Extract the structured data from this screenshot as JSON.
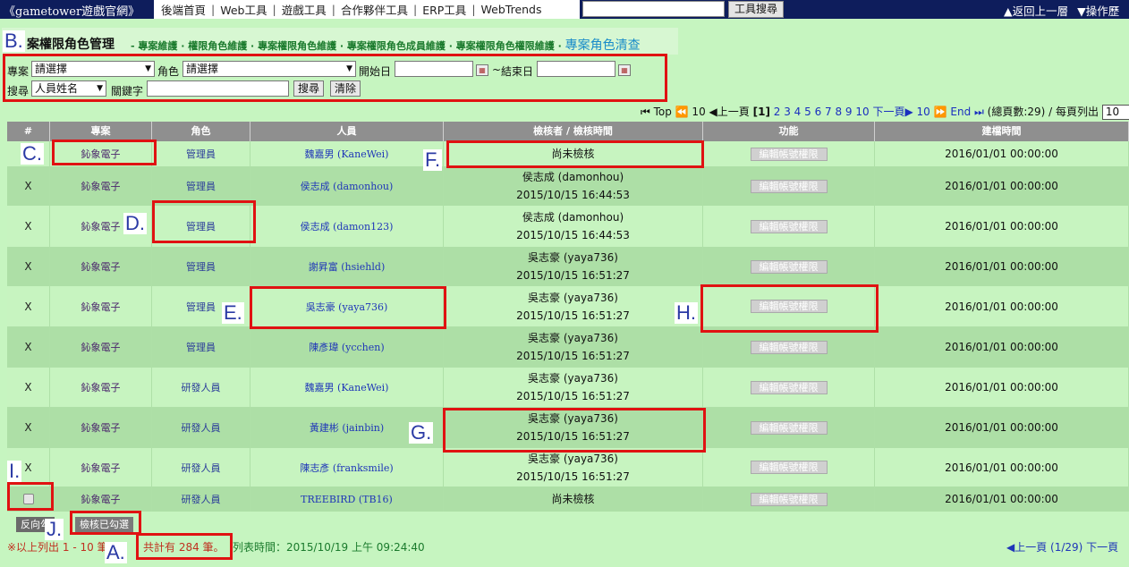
{
  "topbar": {
    "brand": "《gametower遊戲官網》",
    "nav": [
      "後端首頁",
      "Web工具",
      "遊戲工具",
      "合作夥伴工具",
      "ERP工具",
      "WebTrends"
    ],
    "search_value": "",
    "search_button": "工具搜尋",
    "back": "▲返回上一層",
    "history": "▼操作歷"
  },
  "page": {
    "title": "案權限角色管理",
    "crumbs": "- 專案維護 · 權限角色維護 · 專案權限角色維護 · 專案權限角色成員維護 · 專案權限角色權限維護 ·",
    "crumb_current": "專案角色清查"
  },
  "filters": {
    "project_label": "專案",
    "project_value": "請選擇",
    "role_label": "角色",
    "role_value": "請選擇",
    "start_label": "開始日",
    "range_sep": "~",
    "end_label": "結束日",
    "search_label": "搜尋",
    "search_field": "人員姓名",
    "keyword_label": "關鍵字",
    "search_button": "搜尋",
    "clear_button": "清除"
  },
  "pager": {
    "top": "⏮ Top ⏪ 10",
    "prev": "◀上一頁",
    "current": "[1]",
    "pages": "2 3 4 5 6 7 8 9 10",
    "next": "下一頁▶",
    "next10": "10 ⏩",
    "end": "End ⏭",
    "total_pages": "(總頁數:29)",
    "per_page_label": "/ 每頁列出",
    "per_page": "10",
    "tail": "筆"
  },
  "table": {
    "headers": [
      "#",
      "專案",
      "角色",
      "人員",
      "檢核者 / 檢核時間",
      "功能",
      "建檔時間"
    ],
    "rows": [
      {
        "mark": "",
        "project": "鈊象電子",
        "role": "管理員",
        "person": "魏嘉男 (KaneWei)",
        "reviewer": "尚未檢核",
        "review_time": "",
        "action": "編輯帳號權限",
        "created": "2016/01/01 00:00:00"
      },
      {
        "mark": "X",
        "project": "鈊象電子",
        "role": "管理員",
        "person": "侯志成 (damonhou)",
        "reviewer": "侯志成 (damonhou)",
        "review_time": "2015/10/15 16:44:53",
        "action": "編輯帳號權限",
        "created": "2016/01/01 00:00:00"
      },
      {
        "mark": "X",
        "project": "鈊象電子",
        "role": "管理員",
        "person": "侯志成 (damon123)",
        "reviewer": "侯志成 (damonhou)",
        "review_time": "2015/10/15 16:44:53",
        "action": "編輯帳號權限",
        "created": "2016/01/01 00:00:00"
      },
      {
        "mark": "X",
        "project": "鈊象電子",
        "role": "管理員",
        "person": "謝昇富 (hsiehld)",
        "reviewer": "吳志豪 (yaya736)",
        "review_time": "2015/10/15 16:51:27",
        "action": "編輯帳號權限",
        "created": "2016/01/01 00:00:00"
      },
      {
        "mark": "X",
        "project": "鈊象電子",
        "role": "管理員",
        "person": "吳志豪 (yaya736)",
        "reviewer": "吳志豪 (yaya736)",
        "review_time": "2015/10/15 16:51:27",
        "action": "編輯帳號權限",
        "created": "2016/01/01 00:00:00"
      },
      {
        "mark": "X",
        "project": "鈊象電子",
        "role": "管理員",
        "person": "陳彥瑋 (ycchen)",
        "reviewer": "吳志豪 (yaya736)",
        "review_time": "2015/10/15 16:51:27",
        "action": "編輯帳號權限",
        "created": "2016/01/01 00:00:00"
      },
      {
        "mark": "X",
        "project": "鈊象電子",
        "role": "研發人員",
        "person": "魏嘉男 (KaneWei)",
        "reviewer": "吳志豪 (yaya736)",
        "review_time": "2015/10/15 16:51:27",
        "action": "編輯帳號權限",
        "created": "2016/01/01 00:00:00"
      },
      {
        "mark": "X",
        "project": "鈊象電子",
        "role": "研發人員",
        "person": "黃建彬 (jainbin)",
        "reviewer": "吳志豪 (yaya736)",
        "review_time": "2015/10/15 16:51:27",
        "action": "編輯帳號權限",
        "created": "2016/01/01 00:00:00"
      },
      {
        "mark": "X",
        "project": "鈊象電子",
        "role": "研發人員",
        "person": "陳志彥 (franksmile)",
        "reviewer": "吳志豪 (yaya736)",
        "review_time": "2015/10/15 16:51:27",
        "action": "編輯帳號權限",
        "created": "2016/01/01 00:00:00"
      },
      {
        "mark": "checkbox",
        "project": "鈊象電子",
        "role": "研發人員",
        "person": "TREEBIRD (TB16)",
        "reviewer": "尚未檢核",
        "review_time": "",
        "action": "編輯帳號權限",
        "created": "2016/01/01 00:00:00"
      }
    ]
  },
  "actions": {
    "invert": "反向勾",
    "review_checked": "檢核已勾選"
  },
  "footer": {
    "listed": "※以上列出 1 - 10 筆",
    "total": "共計有 284 筆。",
    "list_time": "列表時間：2015/10/19 上午 09:24:40",
    "pagination": "◀上一頁 (1/29) 下一頁"
  },
  "annotations": [
    "A.",
    "B.",
    "C.",
    "D.",
    "E.",
    "F.",
    "G.",
    "H.",
    "I.",
    "J."
  ],
  "colors": {
    "page_bg": "#c6f5c0",
    "topbar_bg": "#0e1d5c",
    "header_bg": "#8f8f8f",
    "row_light": "#c7f4c0",
    "row_dark": "#addfa6",
    "highlight": "#e01212",
    "label_text": "#2b3aa5"
  }
}
